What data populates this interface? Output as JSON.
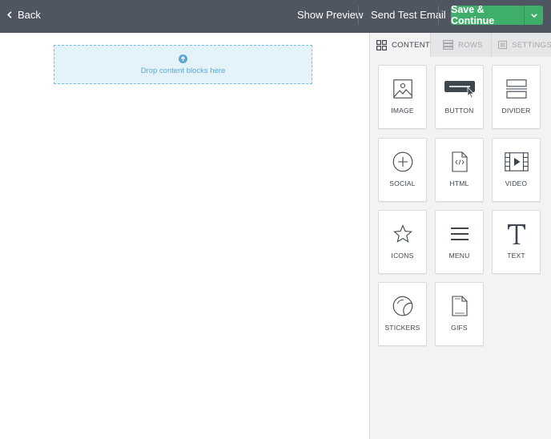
{
  "topbar": {
    "back_label": "Back",
    "show_preview_label": "Show Preview",
    "send_test_label": "Send Test Email",
    "save_label": "Save & Continue"
  },
  "canvas": {
    "dropzone_text": "Drop content blocks here"
  },
  "panel": {
    "tabs": [
      {
        "label": "CONTENT",
        "icon": "grid-icon",
        "active": true
      },
      {
        "label": "ROWS",
        "icon": "rows-icon",
        "active": false
      },
      {
        "label": "SETTINGS",
        "icon": "settings-icon",
        "active": false
      }
    ],
    "tiles": [
      {
        "label": "IMAGE",
        "icon": "image-icon"
      },
      {
        "label": "BUTTON",
        "icon": "button-icon"
      },
      {
        "label": "DIVIDER",
        "icon": "divider-icon"
      },
      {
        "label": "SOCIAL",
        "icon": "social-icon"
      },
      {
        "label": "HTML",
        "icon": "html-icon"
      },
      {
        "label": "VIDEO",
        "icon": "video-icon"
      },
      {
        "label": "ICONS",
        "icon": "star-icon"
      },
      {
        "label": "MENU",
        "icon": "menu-icon"
      },
      {
        "label": "TEXT",
        "icon": "text-icon"
      },
      {
        "label": "STICKERS",
        "icon": "sticker-icon"
      },
      {
        "label": "GIFS",
        "icon": "gif-file-icon"
      }
    ]
  },
  "colors": {
    "topbar_bg": "#505661",
    "save_green": "#3fae6a",
    "dropzone_bg": "#e4f2fa",
    "dropzone_text": "#5aa8d4"
  }
}
